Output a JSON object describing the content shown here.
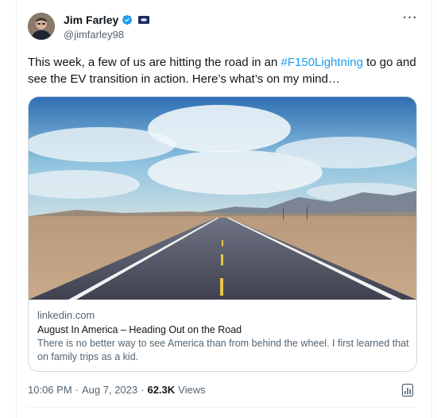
{
  "author": {
    "name": "Jim Farley",
    "handle": "@jimfarley98"
  },
  "tweet": {
    "text_before": "This week, a few of us are hitting the road in an ",
    "hashtag": "#F150Lightning",
    "text_after": " to go and see the EV transition in action. Here’s what’s on my mind…"
  },
  "card": {
    "domain": "linkedin.com",
    "title": "August In America – Heading Out on the Road",
    "description": "There is no better way to see America than from behind the wheel. I first learned that on family trips as a kid."
  },
  "footer": {
    "time": "10:06 PM",
    "date": "Aug 7, 2023",
    "views_count": "62.3K",
    "views_label": "Views",
    "dot": "·"
  },
  "icons": {
    "verified": "verified-badge-icon",
    "affiliate": "affiliate-badge-icon",
    "more": "more-options-icon",
    "analytics": "analytics-icon"
  },
  "colors": {
    "accent": "#1d9bf0",
    "text": "#0f1419",
    "secondary": "#536471"
  }
}
